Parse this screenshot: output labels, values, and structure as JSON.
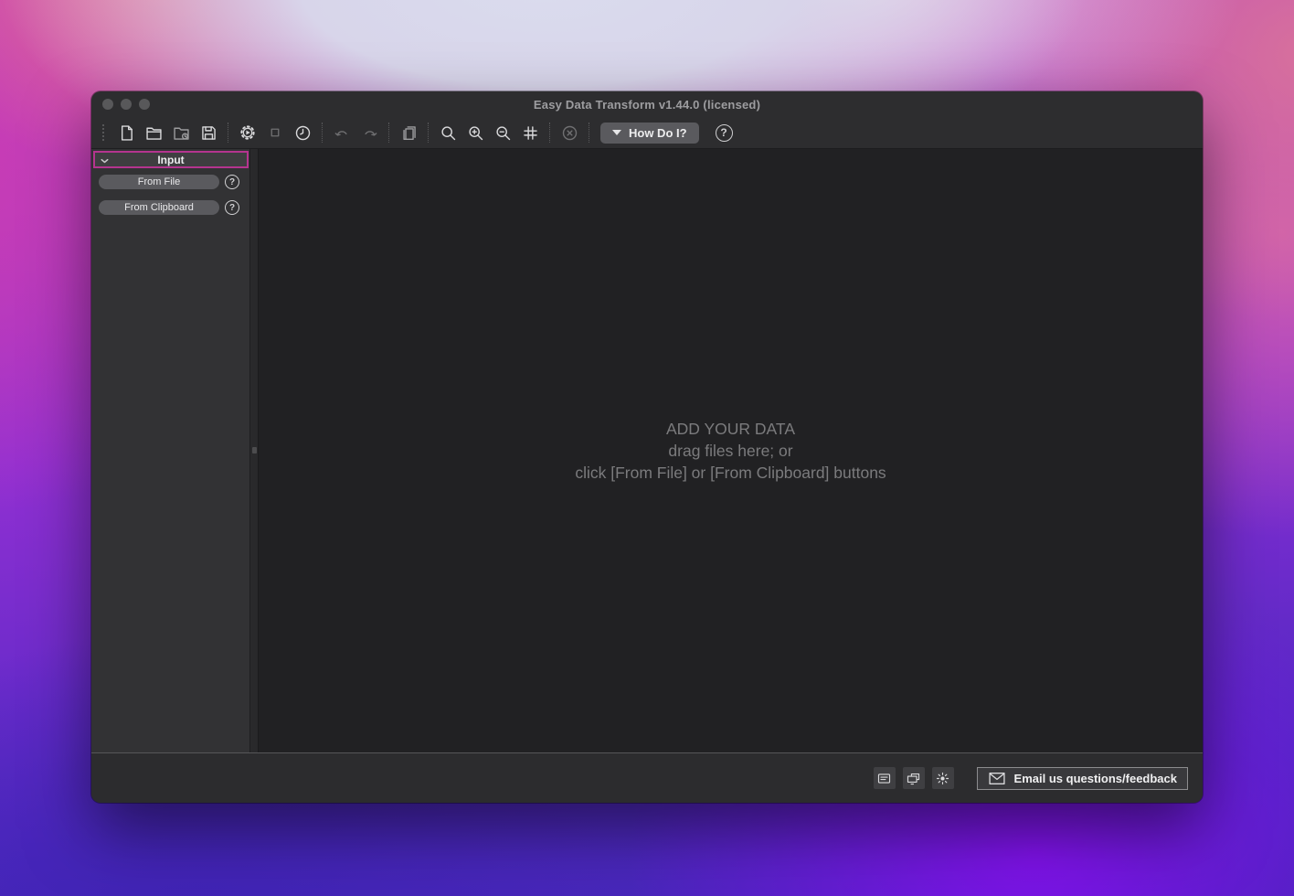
{
  "window": {
    "title": "Easy Data Transform v1.44.0 (licensed)"
  },
  "toolbar": {
    "how_do_i_label": "How Do I?",
    "help_glyph": "?",
    "icons": [
      "new-document",
      "open-folder",
      "open-recent-folder-clock",
      "save-floppy",
      "run-gear-play",
      "stop-square",
      "clock-schedule",
      "undo-arrow",
      "redo-arrow",
      "duplicate-pages",
      "magnifier",
      "magnifier-plus",
      "magnifier-minus",
      "grid-hash",
      "cancel-circle-x",
      "triangle-down",
      "question-circle"
    ]
  },
  "sidebar": {
    "header": "Input",
    "buttons": [
      {
        "label": "From File"
      },
      {
        "label": "From Clipboard"
      }
    ]
  },
  "canvas": {
    "placeholder_line1": "ADD YOUR DATA",
    "placeholder_line2": "drag files here; or",
    "placeholder_line3": "click [From File] or [From Clipboard] buttons"
  },
  "footer": {
    "email_label": "Email us questions/feedback",
    "icons": [
      "notes-log",
      "overlapping-displays",
      "brightness-sun",
      "envelope"
    ]
  },
  "colors": {
    "accent_magenta": "#b5348f",
    "chrome_bg": "#2d2d2f",
    "sidebar_bg": "#323234",
    "canvas_bg": "#212123",
    "placeholder_text": "#7b7b7d",
    "button_gray": "#5a5a5e"
  }
}
